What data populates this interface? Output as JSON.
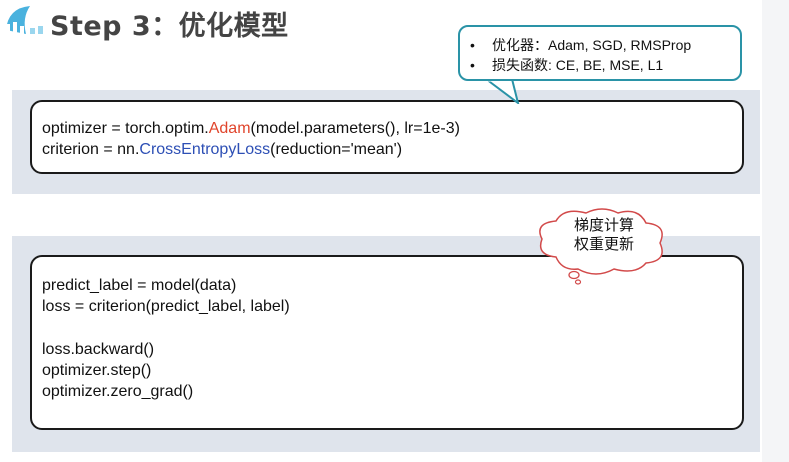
{
  "slide": {
    "title": "Step 3：优化模型"
  },
  "callout": {
    "items": [
      "优化器：Adam, SGD, RMSProp",
      "损失函数: CE, BE, MSE, L1"
    ],
    "bullet": "•"
  },
  "code1": {
    "line1": {
      "pre": "optimizer = torch.optim.",
      "kw": "Adam",
      "post": "(model.parameters(), lr=1e-3)"
    },
    "line2": {
      "pre": "criterion = nn.",
      "kw": "CrossEntropyLoss",
      "post": "(reduction='mean')"
    }
  },
  "code2": {
    "lines": [
      "predict_label = model(data)",
      "loss = criterion(predict_label, label)"
    ],
    "lines_b": [
      "loss.backward()",
      "optimizer.step()",
      "optimizer.zero_grad()"
    ]
  },
  "cloud": {
    "line1": "梯度计算",
    "line2": "权重更新"
  },
  "colors": {
    "keyword_red": "#e0442b",
    "keyword_blue": "#2d4fb5",
    "callout_border": "#2a93a7",
    "panel_bg": "#dfe4ec",
    "logo": "#2aa5d8"
  },
  "icons": {
    "logo": "bilibili-logo-icon"
  }
}
